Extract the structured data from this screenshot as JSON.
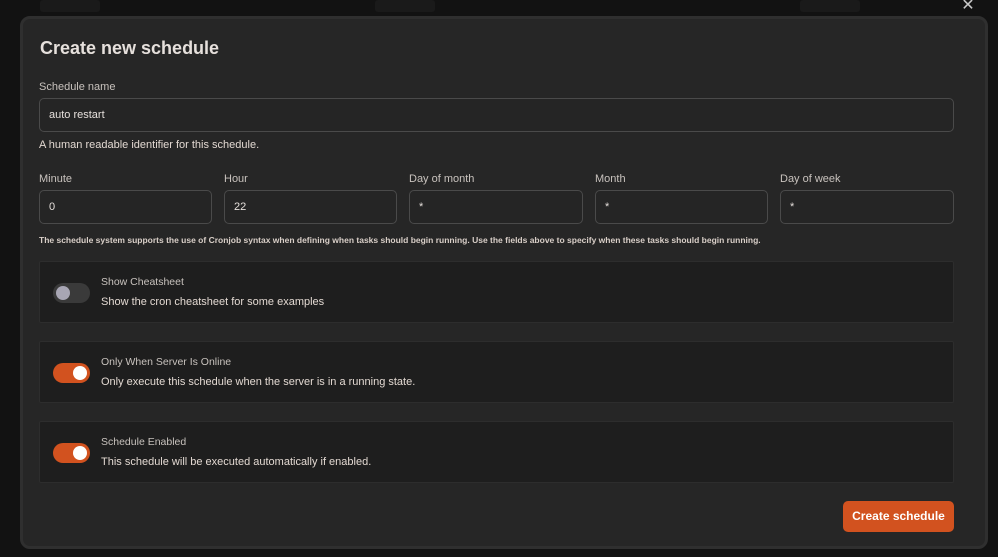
{
  "modal": {
    "title": "Create new schedule",
    "close_icon": "close-icon"
  },
  "schedule_name": {
    "label": "Schedule name",
    "value": "auto restart",
    "helper": "A human readable identifier for this schedule."
  },
  "cron_fields": [
    {
      "label": "Minute",
      "value": "0"
    },
    {
      "label": "Hour",
      "value": "22"
    },
    {
      "label": "Day of month",
      "value": "*"
    },
    {
      "label": "Month",
      "value": "*"
    },
    {
      "label": "Day of week",
      "value": "*"
    }
  ],
  "cron_helper": "The schedule system supports the use of Cronjob syntax when defining when tasks should begin running. Use the fields above to specify when these tasks should begin running.",
  "options": [
    {
      "title": "Show Cheatsheet",
      "description": "Show the cron cheatsheet for some examples",
      "enabled": false
    },
    {
      "title": "Only When Server Is Online",
      "description": "Only execute this schedule when the server is in a running state.",
      "enabled": true
    },
    {
      "title": "Schedule Enabled",
      "description": "This schedule will be executed automatically if enabled.",
      "enabled": true
    }
  ],
  "submit_label": "Create schedule",
  "colors": {
    "accent": "#d2521f",
    "modal_bg": "#262626",
    "panel_bg": "#1e1e1e"
  }
}
